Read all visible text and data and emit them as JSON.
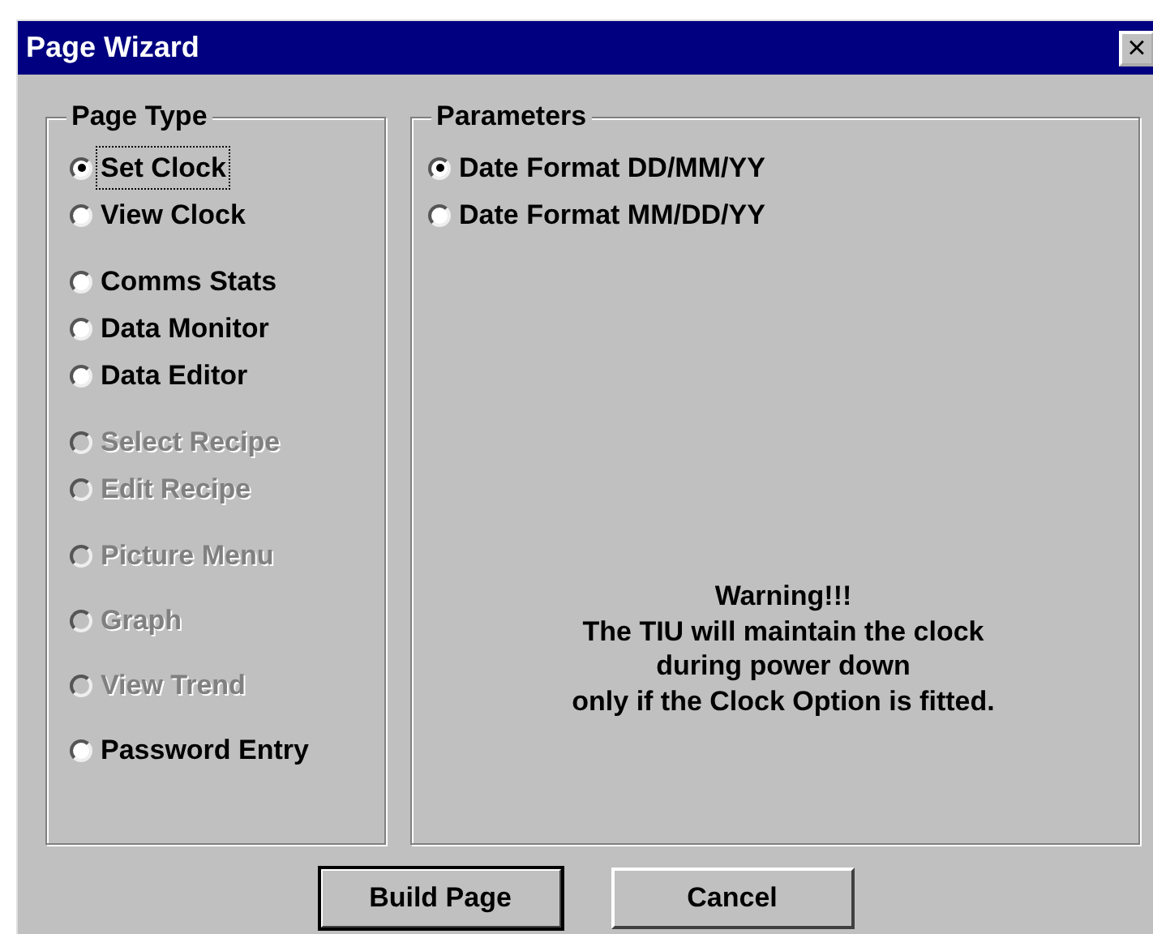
{
  "window": {
    "title": "Page Wizard",
    "close": "×"
  },
  "page_type": {
    "title": "Page Type",
    "groups": [
      [
        {
          "label": "Set Clock",
          "selected": true,
          "disabled": false
        },
        {
          "label": "View Clock",
          "selected": false,
          "disabled": false
        }
      ],
      [
        {
          "label": "Comms Stats",
          "selected": false,
          "disabled": false
        },
        {
          "label": "Data Monitor",
          "selected": false,
          "disabled": false
        },
        {
          "label": "Data Editor",
          "selected": false,
          "disabled": false
        }
      ],
      [
        {
          "label": "Select Recipe",
          "selected": false,
          "disabled": true
        },
        {
          "label": "Edit Recipe",
          "selected": false,
          "disabled": true
        }
      ],
      [
        {
          "label": "Picture Menu",
          "selected": false,
          "disabled": true
        }
      ],
      [
        {
          "label": "Graph",
          "selected": false,
          "disabled": true
        }
      ],
      [
        {
          "label": "View Trend",
          "selected": false,
          "disabled": true
        }
      ],
      [
        {
          "label": "Password Entry",
          "selected": false,
          "disabled": false
        }
      ]
    ]
  },
  "parameters": {
    "title": "Parameters",
    "options": [
      {
        "label": "Date Format DD/MM/YY",
        "selected": true
      },
      {
        "label": "Date Format MM/DD/YY",
        "selected": false
      }
    ],
    "warning": [
      "Warning!!!",
      "The TIU will maintain the clock",
      "during power down",
      "only if the Clock Option is fitted."
    ]
  },
  "buttons": [
    {
      "label": "Build Page",
      "default": true
    },
    {
      "label": "Cancel",
      "default": false
    }
  ]
}
